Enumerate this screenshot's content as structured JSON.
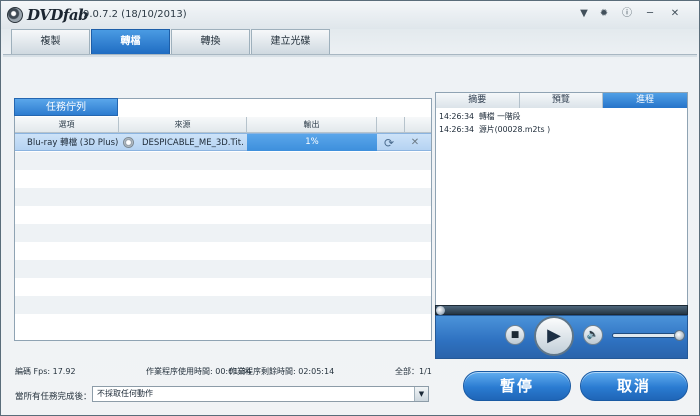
{
  "app": {
    "logo_text": "DVDfab",
    "version": "9.0.7.2 (18/10/2013)"
  },
  "window_controls": {
    "menu_icon": "menu-icon",
    "settings_icon": "gear-icon",
    "info_icon": "info-icon",
    "minimize": "─",
    "close": "✕"
  },
  "tabs": [
    {
      "label": "複製",
      "active": false
    },
    {
      "label": "轉檔",
      "active": true
    },
    {
      "label": "轉換",
      "active": false
    },
    {
      "label": "建立光碟",
      "active": false
    }
  ],
  "queue": {
    "tab_label": "任務佇列",
    "columns": [
      "選項",
      "來源",
      "輸出"
    ],
    "rows": [
      {
        "option": "Blu-ray 轉檔 (3D Plus)",
        "source": "DESPICABLE_ME_3D.Tit...",
        "output": "1%",
        "progress": 0.01
      }
    ]
  },
  "right_panel": {
    "tabs": [
      {
        "label": "摘要",
        "active": false
      },
      {
        "label": "預覽",
        "active": false
      },
      {
        "label": "進程",
        "active": true
      }
    ],
    "log": [
      {
        "time": "14:26:34",
        "text": "轉檔 一階段"
      },
      {
        "time": "14:26:34",
        "text": "源片(00028.m2ts )"
      }
    ]
  },
  "player": {
    "stop": "■",
    "play": "▶",
    "volume": "🔈",
    "volume_level": 0.95,
    "seek_position": 0.0
  },
  "status": {
    "fps": "編碼 Fps: 17.92",
    "elapsed": "作業程序使用時間: 00:01:34",
    "remaining": "作業程序剩餘時間: 02:05:14",
    "total": "全部：1/1"
  },
  "after_done": {
    "label": "當所有任務完成後：",
    "selected": "不採取任何動作"
  },
  "buttons": {
    "pause": "暫停",
    "cancel": "取消"
  }
}
